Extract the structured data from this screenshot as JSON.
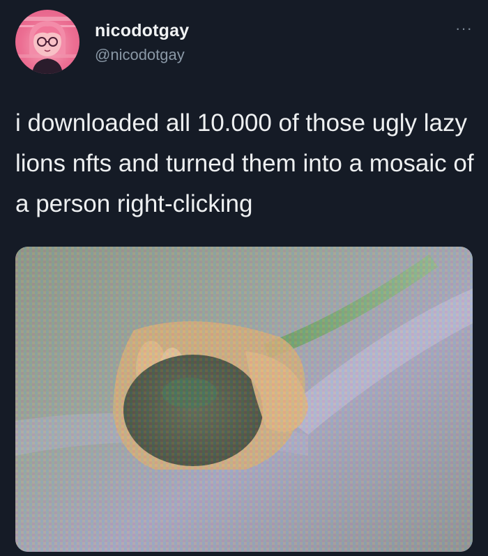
{
  "tweet": {
    "display_name": "nicodotgay",
    "handle": "@nicodotgay",
    "more_label": "···",
    "text": "i downloaded all 10.000 of those ugly lazy lions nfts and turned them into a mosaic of a person right-clicking"
  },
  "colors": {
    "background": "#151b26",
    "avatar_pink": "#ec6f93",
    "handle_gray": "#8a98a6"
  },
  "icons": {
    "more": "more-options-icon",
    "avatar": "avatar-illustration"
  }
}
